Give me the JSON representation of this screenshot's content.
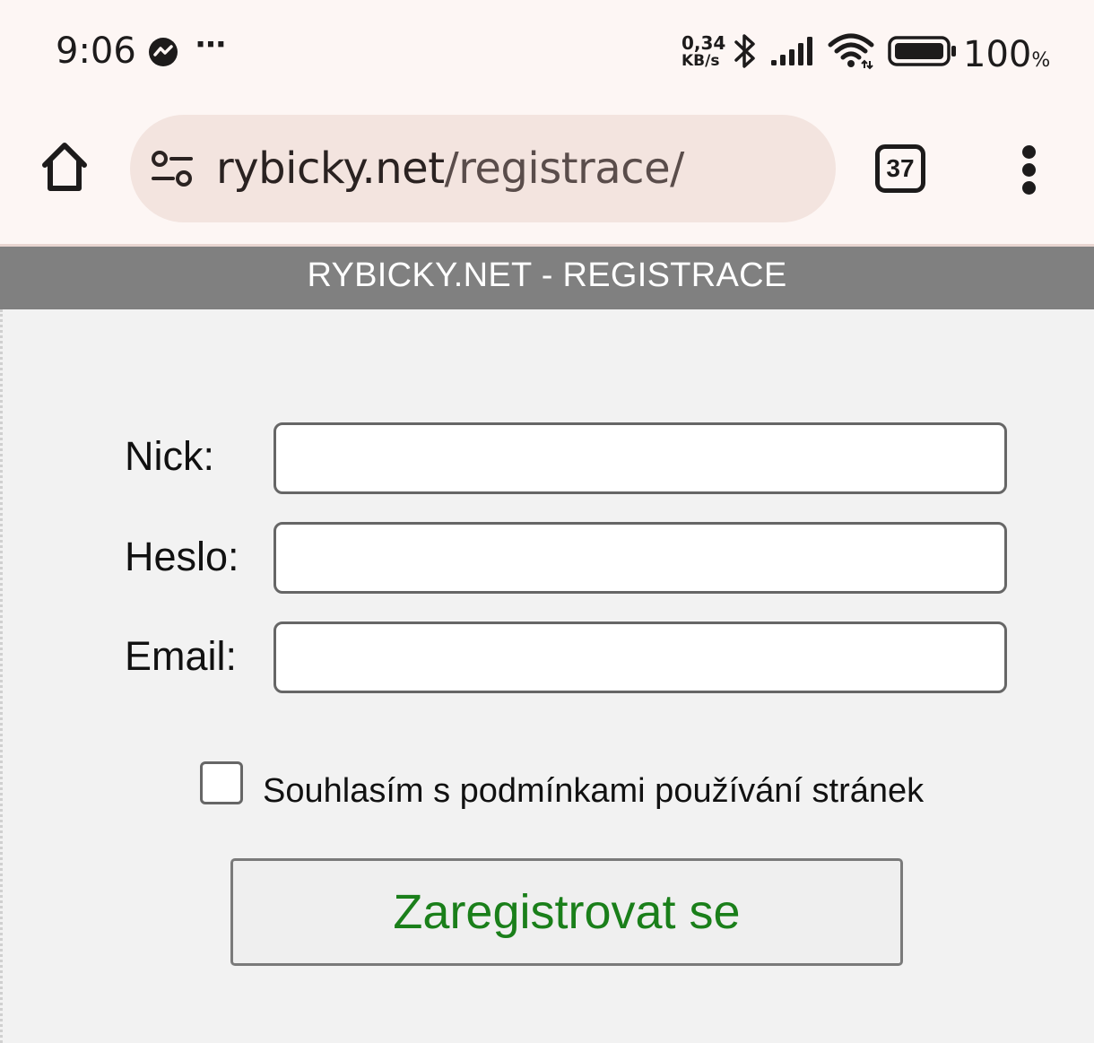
{
  "status_bar": {
    "time": "9:06",
    "notification_icons": [
      "messenger-icon",
      "more-notifications-icon"
    ],
    "more_indicator": "⋯",
    "network_speed_value": "0,34",
    "network_speed_unit": "KB/s",
    "battery_level": "100",
    "battery_unit": "%"
  },
  "browser": {
    "url_host": "rybicky.net",
    "url_path": "/registrace/",
    "tab_count": "37",
    "icons": {
      "home": "home-icon",
      "site_settings": "site-settings-icon",
      "menu": "overflow-menu-icon"
    }
  },
  "page": {
    "header": "RYBICKY.NET - REGISTRACE",
    "form": {
      "nick_label": "Nick:",
      "nick_value": "",
      "password_label": "Heslo:",
      "password_value": "",
      "email_label": "Email:",
      "email_value": "",
      "terms_label": "Souhlasím s podmínkami používání stránek",
      "terms_checked": false,
      "submit_label": "Zaregistrovat se"
    }
  },
  "colors": {
    "header_bg": "#808080",
    "page_bg": "#f2f2f2",
    "submit_text": "#1a7f1a",
    "browser_chrome": "#fdf6f4",
    "url_bar": "#f3e4df"
  }
}
